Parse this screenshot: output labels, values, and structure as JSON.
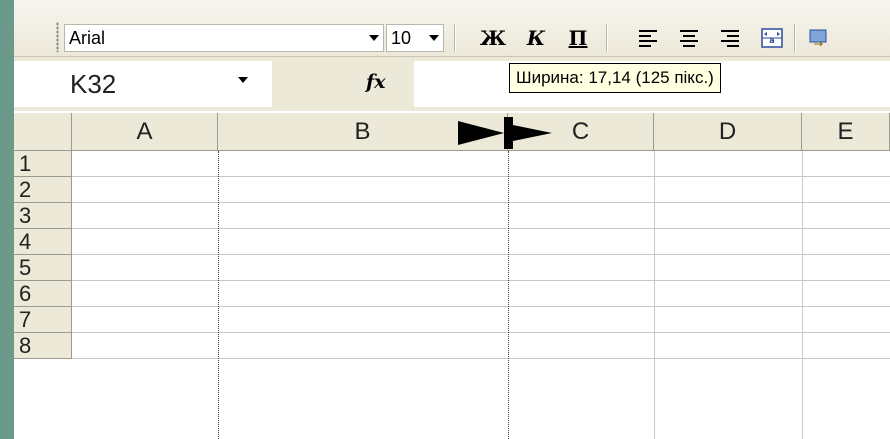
{
  "toolbar": {
    "font_name": "Arial",
    "font_size": "10",
    "bold_label": "Ж",
    "italic_label": "К",
    "underline_label": "П",
    "icons": [
      "align-left-icon",
      "align-center-icon",
      "align-right-icon",
      "merge-center-icon"
    ]
  },
  "tooltip": {
    "text": "Ширина: 17,14 (125 пікс.)"
  },
  "formula_bar": {
    "name_box": "K32",
    "fx_label": "fx",
    "formula_value": ""
  },
  "grid": {
    "columns": [
      "A",
      "B",
      "C",
      "D",
      "E"
    ],
    "rows": [
      "1",
      "2",
      "3",
      "4",
      "5",
      "6",
      "7",
      "8"
    ]
  },
  "colors": {
    "background": "#6b9a8a",
    "header": "#ece9d8",
    "tooltip": "#ffffe1"
  }
}
